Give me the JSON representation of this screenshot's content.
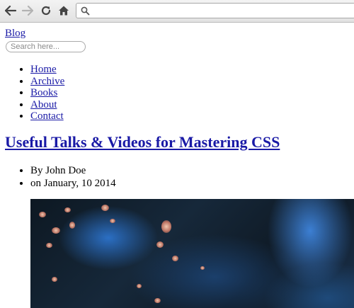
{
  "browser": {
    "back_icon": "back-arrow-icon",
    "forward_icon": "forward-arrow-icon",
    "reload_icon": "reload-icon",
    "home_icon": "home-icon",
    "search_icon": "search-icon",
    "url_value": ""
  },
  "header": {
    "blog_link": "Blog",
    "search_placeholder": "Search here..."
  },
  "nav": {
    "items": [
      {
        "label": "Home"
      },
      {
        "label": "Archive"
      },
      {
        "label": "Books"
      },
      {
        "label": "About"
      },
      {
        "label": "Contact"
      }
    ]
  },
  "post": {
    "title": "Useful Talks & Videos for Mastering CSS",
    "author": "By John Doe",
    "date": "on January, 10 2014"
  },
  "colors": {
    "link": "#1a1aa6",
    "toolbar": "#e8e8e8"
  }
}
